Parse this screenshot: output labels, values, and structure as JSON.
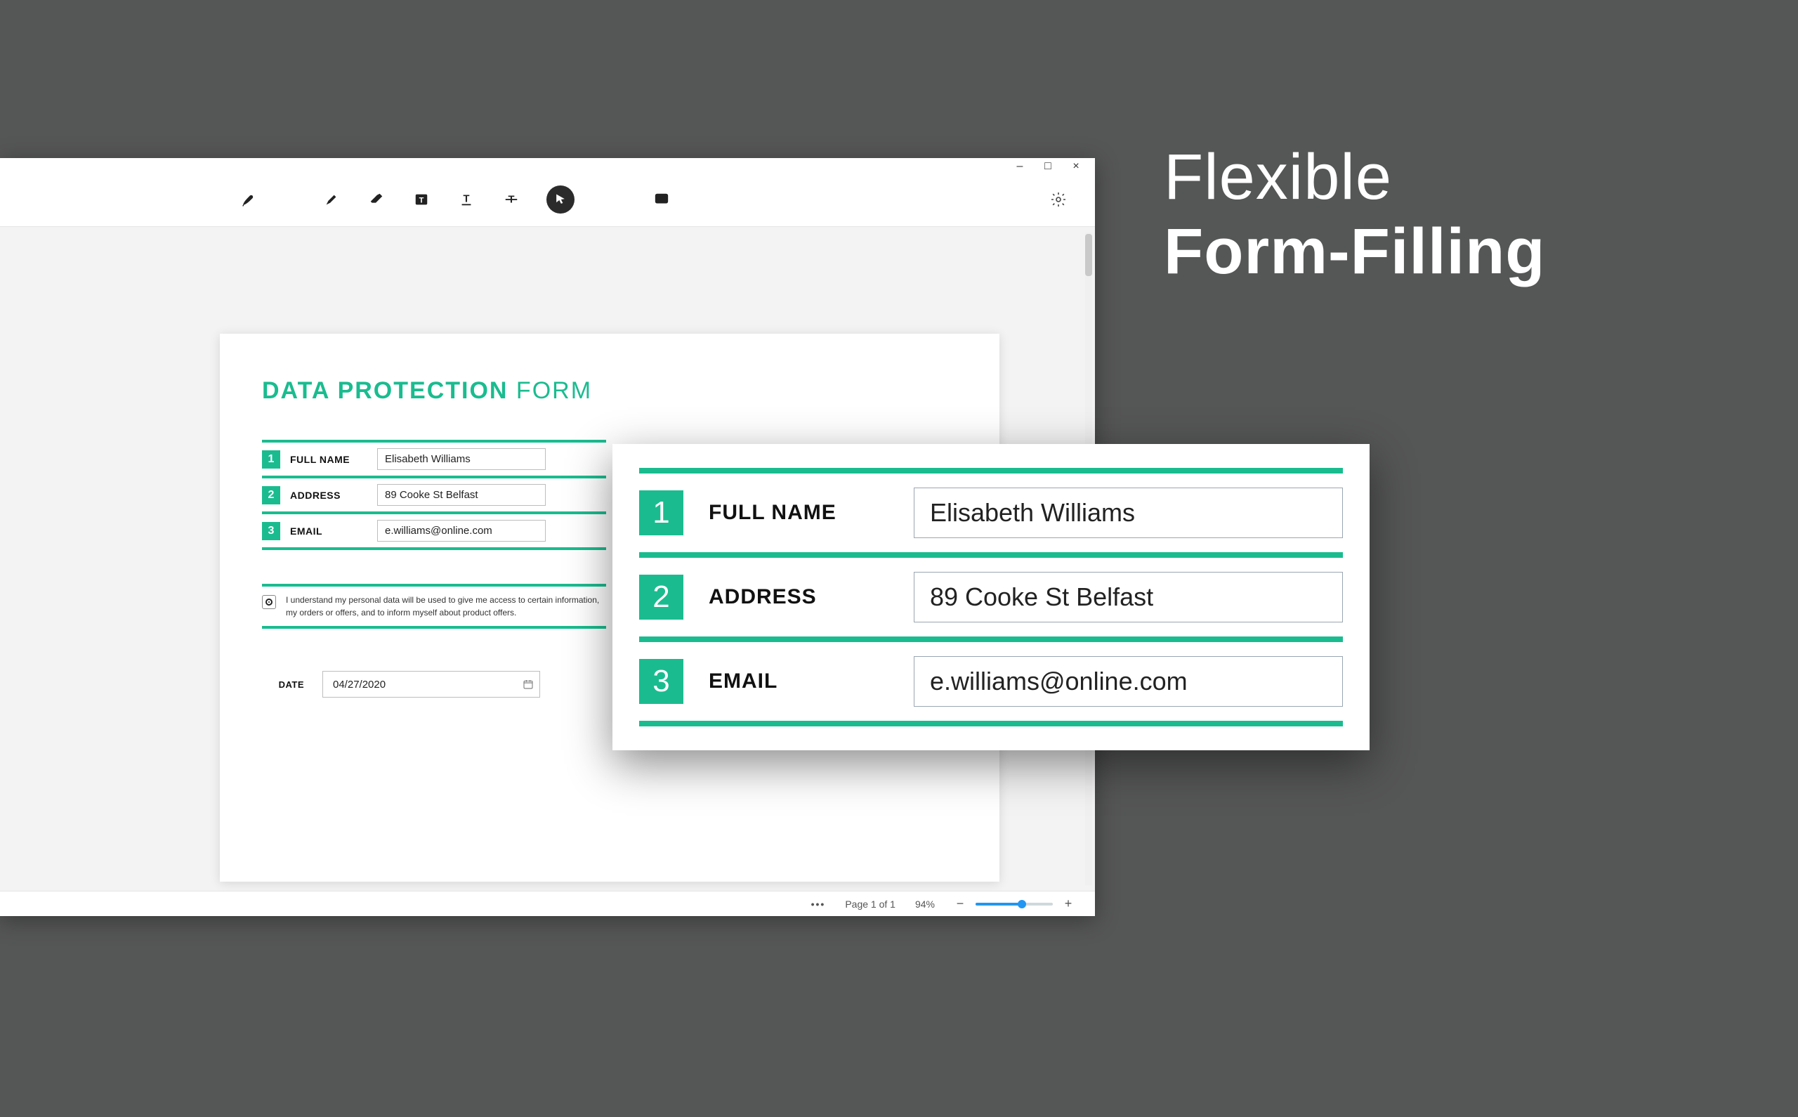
{
  "hero": {
    "line1": "Flexible",
    "line2": "Form-Filling"
  },
  "window": {
    "controls": {
      "min": "–",
      "max": "□",
      "close": "×"
    }
  },
  "toolbar": {
    "icons": {
      "pen": "pen-icon",
      "highlighter": "highlighter-icon",
      "eraser": "eraser-icon",
      "textbox": "textbox-icon",
      "text": "text-icon",
      "strike": "strike-icon",
      "pointer": "pointer-icon",
      "comment": "comment-icon",
      "settings": "settings-icon"
    }
  },
  "form": {
    "title_strong": "DATA PROTECTION",
    "title_thin": "FORM",
    "rows": [
      {
        "num": "1",
        "label": "FULL NAME",
        "value": "Elisabeth Williams"
      },
      {
        "num": "2",
        "label": "ADDRESS",
        "value": "89 Cooke St Belfast"
      },
      {
        "num": "3",
        "label": "EMAIL",
        "value": "e.williams@online.com"
      }
    ],
    "consent": "I understand my personal data will be used to give me access to certain information, my orders or offers, and to inform myself about product offers.",
    "date_label": "DATE",
    "date_value": "04/27/2020"
  },
  "status": {
    "page": "Page 1 of 1",
    "zoom": "94%"
  },
  "colors": {
    "accent": "#1abc8f",
    "bg": "#555656"
  }
}
